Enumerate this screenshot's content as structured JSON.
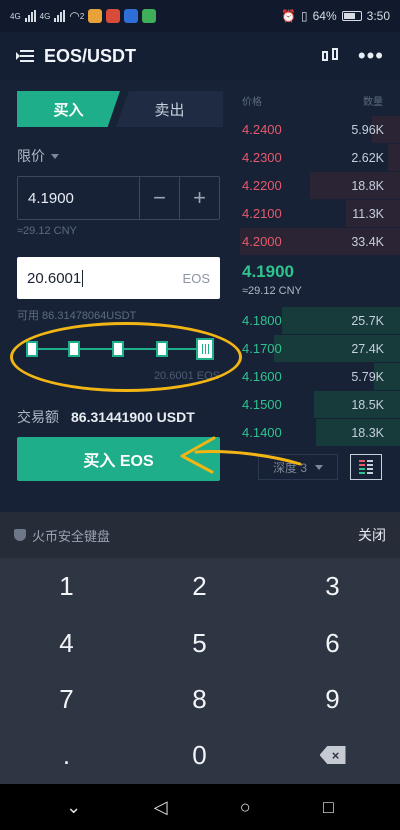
{
  "status_bar": {
    "network_left": "4G",
    "network_right": "4G",
    "notification_count": "2",
    "battery": "64%",
    "time": "3:50"
  },
  "header": {
    "title": "EOS/USDT",
    "kline_icon": "candlestick-chart-icon",
    "more_icon": "more-icon"
  },
  "trade": {
    "tab_buy": "买入",
    "tab_sell": "卖出",
    "order_type": "限价",
    "price_value": "4.1900",
    "price_cny": "≈29.12 CNY",
    "amount_value": "20.6001",
    "amount_unit": "EOS",
    "available": "可用 86.31478064USDT",
    "slider_percent": 100,
    "slider_amount": "20.6001 EOS",
    "total_label": "交易额",
    "total_value": "86.31441900 USDT",
    "buy_button": "买入 EOS"
  },
  "orderbook": {
    "col_price": "价格",
    "col_qty": "数量",
    "asks": [
      {
        "price": "4.2400",
        "qty": "5.96K"
      },
      {
        "price": "4.2300",
        "qty": "2.62K"
      },
      {
        "price": "4.2200",
        "qty": "18.8K"
      },
      {
        "price": "4.2100",
        "qty": "11.3K"
      },
      {
        "price": "4.2000",
        "qty": "33.4K"
      }
    ],
    "last_price": "4.1900",
    "last_price_cny": "≈29.12 CNY",
    "bids": [
      {
        "price": "4.1800",
        "qty": "25.7K"
      },
      {
        "price": "4.1700",
        "qty": "27.4K"
      },
      {
        "price": "4.1600",
        "qty": "5.79K"
      },
      {
        "price": "4.1500",
        "qty": "18.5K"
      },
      {
        "price": "4.1400",
        "qty": "18.3K"
      }
    ],
    "depth_label": "深度 3"
  },
  "keyboard": {
    "title": "火币安全键盘",
    "close": "关闭",
    "keys": [
      "1",
      "2",
      "3",
      "4",
      "5",
      "6",
      "7",
      "8",
      "9",
      ".",
      "0"
    ]
  },
  "colors": {
    "buy_green": "#1fae8a",
    "ask_red": "#e65a6a",
    "bid_green": "#2fc38e",
    "annotation": "#f2b514"
  }
}
